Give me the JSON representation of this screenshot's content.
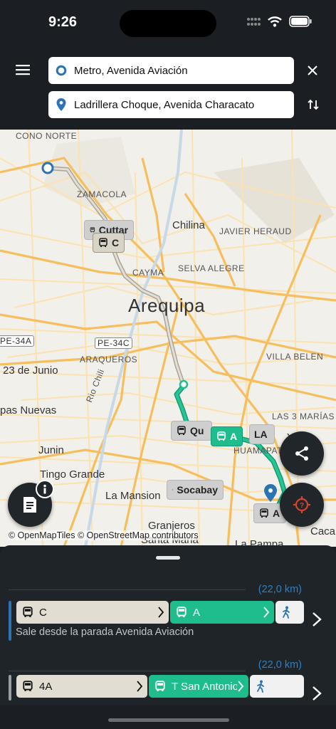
{
  "status": {
    "time": "9:26"
  },
  "search": {
    "origin": "Metro, Avenida Aviación",
    "destination": "Ladrillera Choque, Avenida Characato"
  },
  "map": {
    "labels": {
      "cono_norte": "CONO NORTE",
      "zamacola": "ZAMACOLA",
      "chilina": "Chilina",
      "javier_heraud": "JAVIER HERAUD",
      "cayma": "CAYMA",
      "selva_alegre": "SELVA ALEGRE",
      "arequipa": "Arequipa",
      "pe34a": "PE-34A",
      "pe34c": "PE-34C",
      "araqueros": "ARAQUEROS",
      "villa_belen": "VILLA BELEN",
      "junio": "23 de Junio",
      "rio_chili": "Rio Chili",
      "nuevas": "pas Nuevas",
      "tres_marias": "LAS 3 MARÍAS",
      "junin": "Junin",
      "huamanpata": "HUAMAPATA",
      "tingo": "Tingo Grande",
      "la_mansion": "La Mansion",
      "granjeros": "Granjeros",
      "santa_maria": "Santa Maria",
      "la_pampa": "La Pampa",
      "caca": "Caca",
      "la": "LA",
      "ya": "Ya"
    },
    "stops": {
      "c_upper": "Cuttar",
      "c_lower": "C",
      "a_chip": "A",
      "qu": "Qu",
      "socabaya": "Socabay",
      "a_bottom": "A"
    },
    "attribution": "© OpenMapTiles © OpenStreetMap contributors"
  },
  "routes": [
    {
      "distance": "(22,0 km)",
      "segments": [
        "C",
        "A"
      ],
      "description": "Sale desde la parada Avenida Aviación"
    },
    {
      "distance": "(22,0 km)",
      "segments": [
        "4A",
        "T San Antonio"
      ]
    }
  ],
  "colors": {
    "green": "#1fbd8e",
    "accent_blue": "#2a73b4",
    "fab_red": "#d9432f"
  }
}
